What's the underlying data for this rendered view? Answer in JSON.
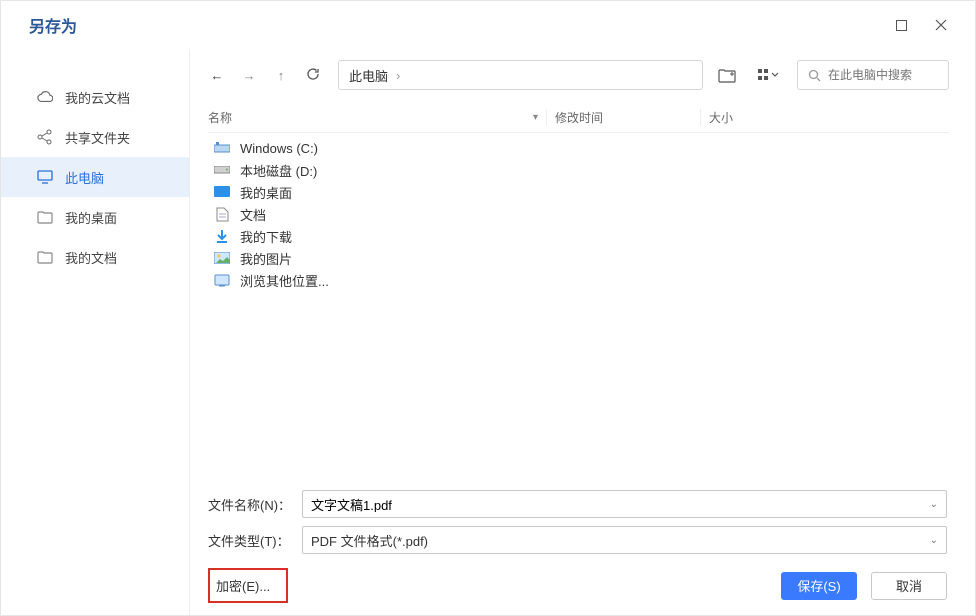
{
  "title": "另存为",
  "sidebar": {
    "items": [
      {
        "label": "我的云文档",
        "icon": "cloud-icon",
        "selected": false
      },
      {
        "label": "共享文件夹",
        "icon": "share-icon",
        "selected": false
      },
      {
        "label": "此电脑",
        "icon": "pc-icon",
        "selected": true
      },
      {
        "label": "我的桌面",
        "icon": "folder-icon",
        "selected": false
      },
      {
        "label": "我的文档",
        "icon": "folder-icon",
        "selected": false
      }
    ]
  },
  "toolbar": {
    "breadcrumb": "此电脑",
    "search_placeholder": "在此电脑中搜索"
  },
  "columns": {
    "name": "名称",
    "modified": "修改时间",
    "size": "大小"
  },
  "files": [
    {
      "label": "Windows (C:)",
      "icon": "drive-c-icon"
    },
    {
      "label": "本地磁盘 (D:)",
      "icon": "drive-icon"
    },
    {
      "label": "我的桌面",
      "icon": "desktop-icon"
    },
    {
      "label": "文档",
      "icon": "doc-icon"
    },
    {
      "label": "我的下载",
      "icon": "download-icon"
    },
    {
      "label": "我的图片",
      "icon": "picture-icon"
    },
    {
      "label": "浏览其他位置...",
      "icon": "browse-icon"
    }
  ],
  "form": {
    "filename_label": "文件名称(N)：",
    "filename_value": "文字文稿1.pdf",
    "filetype_label": "文件类型(T)：",
    "filetype_value": "PDF 文件格式(*.pdf)",
    "encrypt_label": "加密(E)..."
  },
  "actions": {
    "save": "保存(S)",
    "cancel": "取消"
  }
}
